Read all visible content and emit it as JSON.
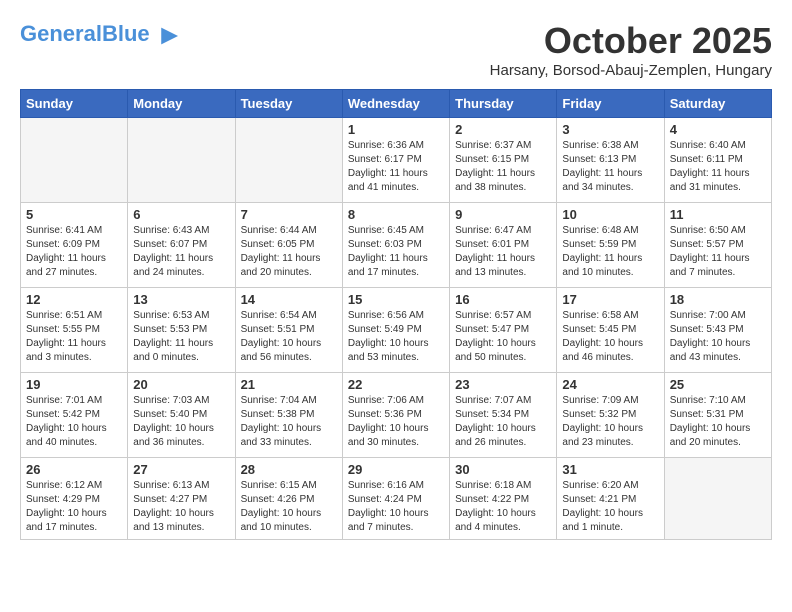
{
  "header": {
    "logo_general": "General",
    "logo_blue": "Blue",
    "month_title": "October 2025",
    "location": "Harsany, Borsod-Abauj-Zemplen, Hungary"
  },
  "weekdays": [
    "Sunday",
    "Monday",
    "Tuesday",
    "Wednesday",
    "Thursday",
    "Friday",
    "Saturday"
  ],
  "weeks": [
    [
      {
        "day": "",
        "empty": true
      },
      {
        "day": "",
        "empty": true
      },
      {
        "day": "",
        "empty": true
      },
      {
        "day": "1",
        "sunrise": "6:36 AM",
        "sunset": "6:17 PM",
        "daylight": "11 hours and 41 minutes."
      },
      {
        "day": "2",
        "sunrise": "6:37 AM",
        "sunset": "6:15 PM",
        "daylight": "11 hours and 38 minutes."
      },
      {
        "day": "3",
        "sunrise": "6:38 AM",
        "sunset": "6:13 PM",
        "daylight": "11 hours and 34 minutes."
      },
      {
        "day": "4",
        "sunrise": "6:40 AM",
        "sunset": "6:11 PM",
        "daylight": "11 hours and 31 minutes."
      }
    ],
    [
      {
        "day": "5",
        "sunrise": "6:41 AM",
        "sunset": "6:09 PM",
        "daylight": "11 hours and 27 minutes."
      },
      {
        "day": "6",
        "sunrise": "6:43 AM",
        "sunset": "6:07 PM",
        "daylight": "11 hours and 24 minutes."
      },
      {
        "day": "7",
        "sunrise": "6:44 AM",
        "sunset": "6:05 PM",
        "daylight": "11 hours and 20 minutes."
      },
      {
        "day": "8",
        "sunrise": "6:45 AM",
        "sunset": "6:03 PM",
        "daylight": "11 hours and 17 minutes."
      },
      {
        "day": "9",
        "sunrise": "6:47 AM",
        "sunset": "6:01 PM",
        "daylight": "11 hours and 13 minutes."
      },
      {
        "day": "10",
        "sunrise": "6:48 AM",
        "sunset": "5:59 PM",
        "daylight": "11 hours and 10 minutes."
      },
      {
        "day": "11",
        "sunrise": "6:50 AM",
        "sunset": "5:57 PM",
        "daylight": "11 hours and 7 minutes."
      }
    ],
    [
      {
        "day": "12",
        "sunrise": "6:51 AM",
        "sunset": "5:55 PM",
        "daylight": "11 hours and 3 minutes."
      },
      {
        "day": "13",
        "sunrise": "6:53 AM",
        "sunset": "5:53 PM",
        "daylight": "11 hours and 0 minutes."
      },
      {
        "day": "14",
        "sunrise": "6:54 AM",
        "sunset": "5:51 PM",
        "daylight": "10 hours and 56 minutes."
      },
      {
        "day": "15",
        "sunrise": "6:56 AM",
        "sunset": "5:49 PM",
        "daylight": "10 hours and 53 minutes."
      },
      {
        "day": "16",
        "sunrise": "6:57 AM",
        "sunset": "5:47 PM",
        "daylight": "10 hours and 50 minutes."
      },
      {
        "day": "17",
        "sunrise": "6:58 AM",
        "sunset": "5:45 PM",
        "daylight": "10 hours and 46 minutes."
      },
      {
        "day": "18",
        "sunrise": "7:00 AM",
        "sunset": "5:43 PM",
        "daylight": "10 hours and 43 minutes."
      }
    ],
    [
      {
        "day": "19",
        "sunrise": "7:01 AM",
        "sunset": "5:42 PM",
        "daylight": "10 hours and 40 minutes."
      },
      {
        "day": "20",
        "sunrise": "7:03 AM",
        "sunset": "5:40 PM",
        "daylight": "10 hours and 36 minutes."
      },
      {
        "day": "21",
        "sunrise": "7:04 AM",
        "sunset": "5:38 PM",
        "daylight": "10 hours and 33 minutes."
      },
      {
        "day": "22",
        "sunrise": "7:06 AM",
        "sunset": "5:36 PM",
        "daylight": "10 hours and 30 minutes."
      },
      {
        "day": "23",
        "sunrise": "7:07 AM",
        "sunset": "5:34 PM",
        "daylight": "10 hours and 26 minutes."
      },
      {
        "day": "24",
        "sunrise": "7:09 AM",
        "sunset": "5:32 PM",
        "daylight": "10 hours and 23 minutes."
      },
      {
        "day": "25",
        "sunrise": "7:10 AM",
        "sunset": "5:31 PM",
        "daylight": "10 hours and 20 minutes."
      }
    ],
    [
      {
        "day": "26",
        "sunrise": "6:12 AM",
        "sunset": "4:29 PM",
        "daylight": "10 hours and 17 minutes."
      },
      {
        "day": "27",
        "sunrise": "6:13 AM",
        "sunset": "4:27 PM",
        "daylight": "10 hours and 13 minutes."
      },
      {
        "day": "28",
        "sunrise": "6:15 AM",
        "sunset": "4:26 PM",
        "daylight": "10 hours and 10 minutes."
      },
      {
        "day": "29",
        "sunrise": "6:16 AM",
        "sunset": "4:24 PM",
        "daylight": "10 hours and 7 minutes."
      },
      {
        "day": "30",
        "sunrise": "6:18 AM",
        "sunset": "4:22 PM",
        "daylight": "10 hours and 4 minutes."
      },
      {
        "day": "31",
        "sunrise": "6:20 AM",
        "sunset": "4:21 PM",
        "daylight": "10 hours and 1 minute."
      },
      {
        "day": "",
        "empty": true
      }
    ]
  ]
}
